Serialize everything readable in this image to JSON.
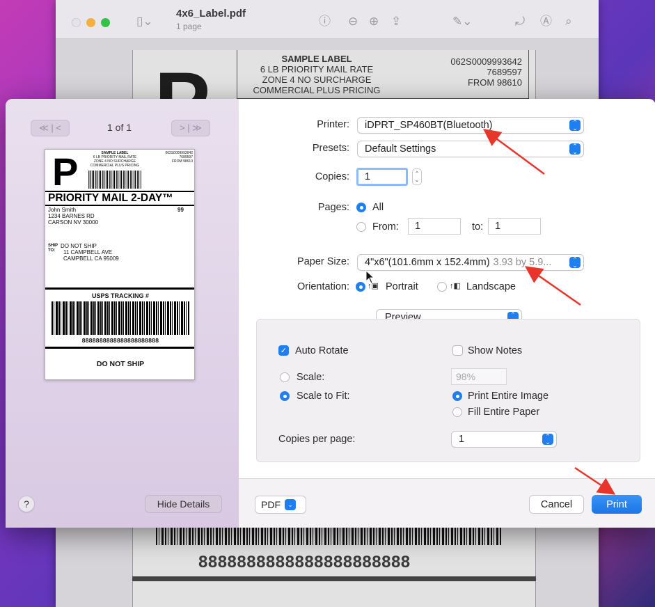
{
  "window": {
    "title": "4x6_Label.pdf",
    "subtitle": "1 page"
  },
  "background_label": {
    "header_lines": [
      "SAMPLE LABEL",
      "6 LB PRIORITY MAIL RATE",
      "ZONE 4 NO SURCHARGE",
      "COMMERCIAL PLUS PRICING"
    ],
    "right_lines": [
      "062S0009993642",
      "7689597",
      "FROM 98610"
    ],
    "big_letter": "P",
    "tracking_number": "8888888888888888888888"
  },
  "preview_nav": {
    "first_prev": "≪ | <",
    "page_indicator": "1 of 1",
    "next_last": "> | ≫"
  },
  "thumbnail": {
    "big_letter": "P",
    "header_lines": [
      "SAMPLE LABEL",
      "6 LB PRIORITY MAIL RATE",
      "ZONE 4 NO SURCHARGE",
      "COMMERCIAL PLUS PRICING"
    ],
    "right_lines": [
      "062S0009993642",
      "7689597",
      "FROM 98610"
    ],
    "service": "PRIORITY MAIL 2-DAY™",
    "from_lines": [
      "John Smith",
      "1234 BARNES RD",
      "CARSON NV 30000"
    ],
    "zone_code": "99",
    "ship_to_label": [
      "SHIP",
      "TO:"
    ],
    "to_lines": [
      "DO NOT SHIP",
      "11 CAMPBELL AVE",
      "CAMPBELL CA 95009"
    ],
    "tracking_label": "USPS TRACKING #",
    "tracking_number": "8888888888888888888888",
    "footer": "DO NOT SHIP"
  },
  "form": {
    "printer_label": "Printer:",
    "printer_value": "iDPRT_SP460BT(Bluetooth)",
    "presets_label": "Presets:",
    "presets_value": "Default Settings",
    "copies_label": "Copies:",
    "copies_value": "1",
    "pages_label": "Pages:",
    "pages_all": "All",
    "pages_from": "From:",
    "pages_from_value": "1",
    "pages_to": "to:",
    "pages_to_value": "1",
    "paper_size_label": "Paper Size:",
    "paper_size_value": "4\"x6\"(101.6mm x 152.4mm)",
    "paper_size_dims": "3.93 by 5.9...",
    "orientation_label": "Orientation:",
    "orientation_portrait": "Portrait",
    "orientation_landscape": "Landscape",
    "section_value": "Preview"
  },
  "preview_panel": {
    "auto_rotate": "Auto Rotate",
    "show_notes": "Show Notes",
    "scale": "Scale:",
    "scale_value": "98%",
    "scale_to_fit": "Scale to Fit:",
    "print_entire_image": "Print Entire Image",
    "fill_entire_paper": "Fill Entire Paper",
    "copies_per_page": "Copies per page:",
    "copies_per_page_value": "1"
  },
  "footer": {
    "help": "?",
    "hide_details": "Hide Details",
    "pdf": "PDF",
    "cancel": "Cancel",
    "print": "Print"
  },
  "colors": {
    "accent": "#1f7ff0",
    "annotation_arrow": "#e8352b"
  }
}
